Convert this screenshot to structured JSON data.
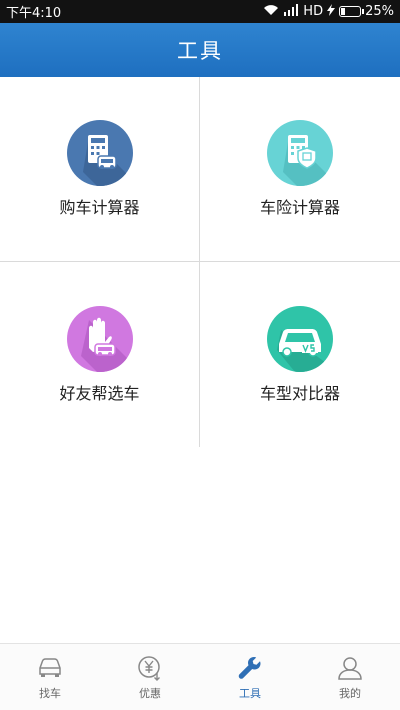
{
  "status_bar": {
    "time": "下午4:10",
    "network": "HD",
    "battery": "25%",
    "battery_level": 0.25
  },
  "header": {
    "title": "工具"
  },
  "tools": [
    {
      "label": "购车计算器",
      "icon": "car-purchase-calculator-icon",
      "color": "#4a78b0"
    },
    {
      "label": "车险计算器",
      "icon": "car-insurance-calculator-icon",
      "color": "#67d3d5"
    },
    {
      "label": "好友帮选车",
      "icon": "friend-help-choose-car-icon",
      "color": "#d078e0"
    },
    {
      "label": "车型对比器",
      "icon": "car-model-compare-icon",
      "color": "#2fc4a8"
    }
  ],
  "tabbar": {
    "items": [
      {
        "label": "找车",
        "icon": "car-icon",
        "active": false
      },
      {
        "label": "优惠",
        "icon": "yuan-coin-icon",
        "active": false
      },
      {
        "label": "工具",
        "icon": "wrench-icon",
        "active": true
      },
      {
        "label": "我的",
        "icon": "person-icon",
        "active": false
      }
    ],
    "active_color": "#2f6fb5"
  }
}
